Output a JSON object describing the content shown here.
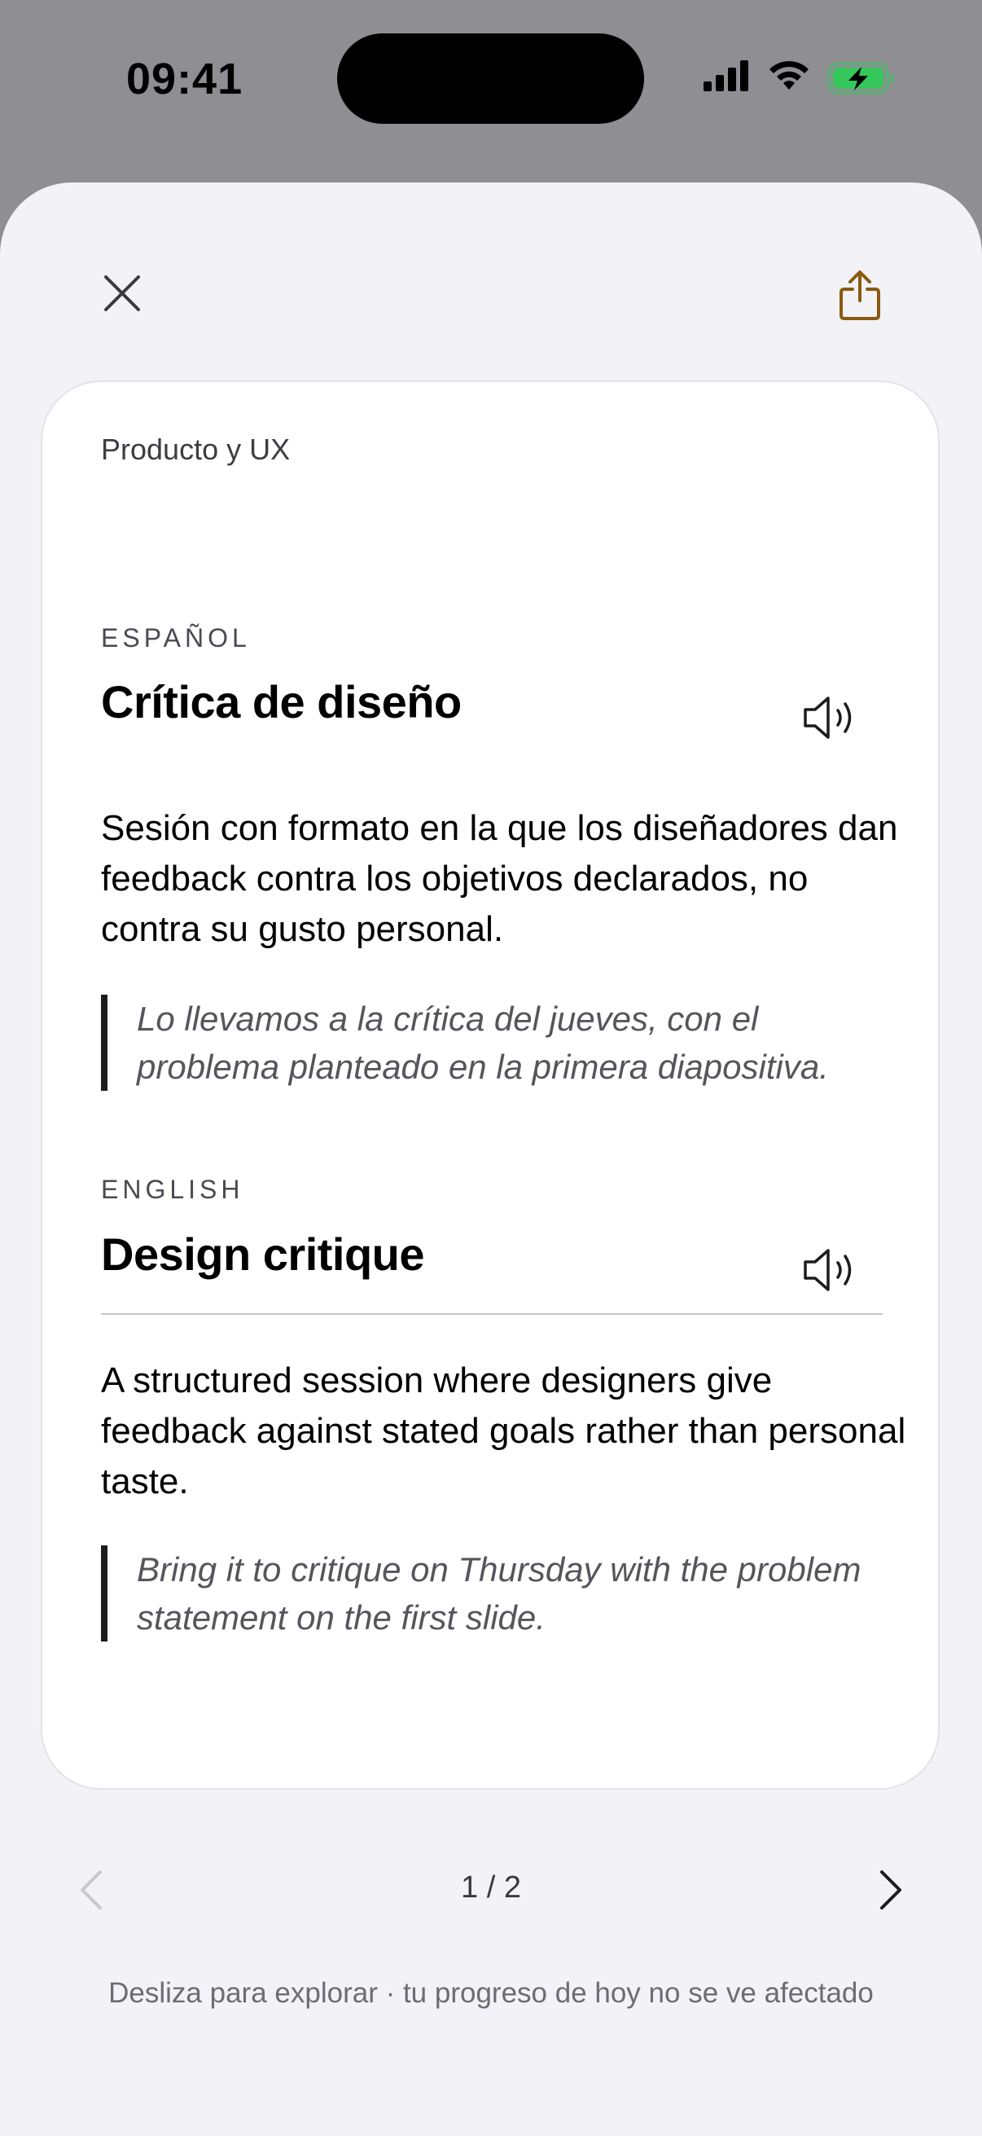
{
  "status_bar": {
    "time": "09:41",
    "battery_color": "#34c759"
  },
  "sheet": {
    "close_icon": "close-icon",
    "share_icon": "share-icon",
    "accent_color": "#8a5a10"
  },
  "card": {
    "category": "Producto y UX",
    "spanish": {
      "language": "ESPAÑOL",
      "term": "Crítica de diseño",
      "definition": "Sesión con formato en la que los diseñadores dan feedback contra los objetivos declarados, no contra su gusto personal.",
      "example": "Lo llevamos a la crítica del jueves, con el problema planteado en la primera diapositiva."
    },
    "english": {
      "language": "ENGLISH",
      "term": "Design critique",
      "definition": "A structured session where designers give feedback against stated goals rather than personal taste.",
      "example": "Bring it to critique on Thursday with the problem statement on the first slide."
    }
  },
  "pager": {
    "count": "1 / 2",
    "prev_enabled": false,
    "next_enabled": true
  },
  "hint": "Desliza para explorar · tu progreso de hoy no se ve afectado"
}
